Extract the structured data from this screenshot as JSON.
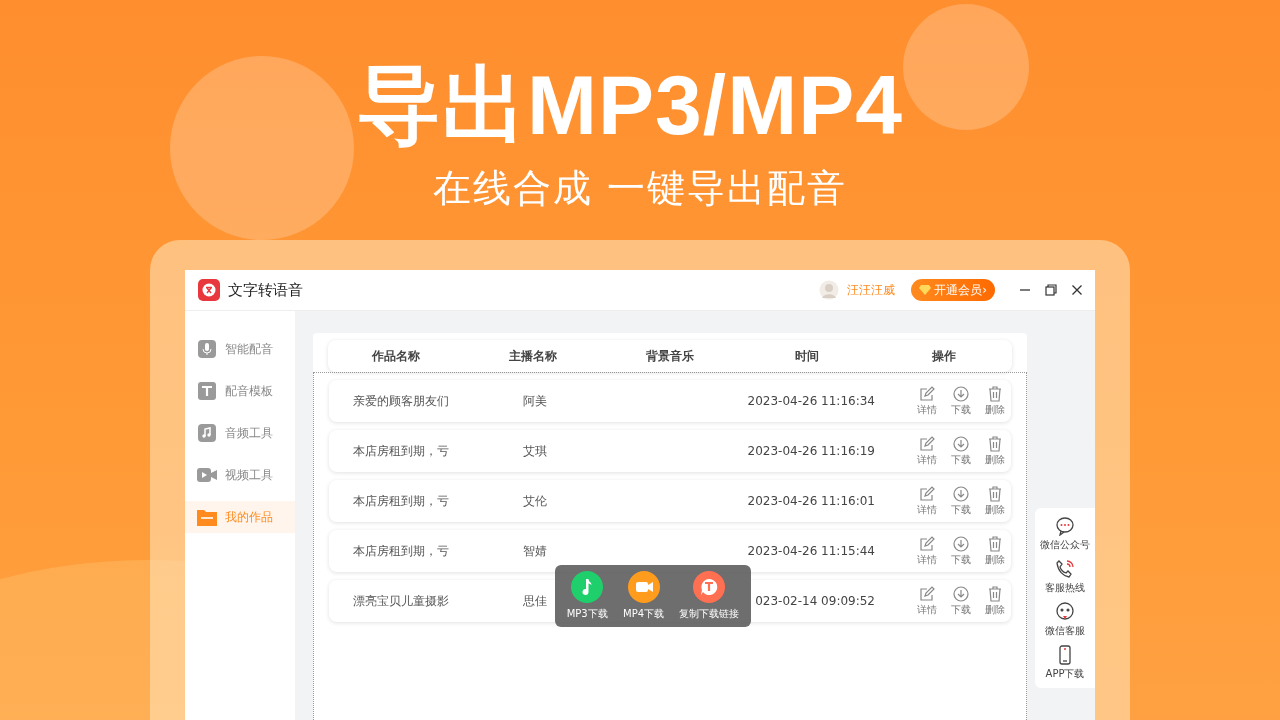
{
  "headline": "导出MP3/MP4",
  "subheadline": "在线合成 一键导出配音",
  "app": {
    "title": "文字转语音",
    "user": "汪汪汪威",
    "vip_button": "开通会员›"
  },
  "sidebar": {
    "items": [
      {
        "label": "智能配音",
        "selected": false
      },
      {
        "label": "配音模板",
        "selected": false
      },
      {
        "label": "音频工具",
        "selected": false
      },
      {
        "label": "视频工具",
        "selected": false
      },
      {
        "label": "我的作品",
        "selected": true
      }
    ]
  },
  "table": {
    "columns": [
      "作品名称",
      "主播名称",
      "背景音乐",
      "时间",
      "操作"
    ],
    "rows": [
      {
        "name": "亲爱的顾客朋友们",
        "anchor": "阿美",
        "time": "2023-04-26 11:16:34",
        "actions": [
          "详情",
          "下载",
          "删除"
        ]
      },
      {
        "name": "本店房租到期，亏",
        "anchor": "艾琪",
        "time": "2023-04-26 11:16:19",
        "actions": [
          "详情",
          "下载",
          "删除"
        ]
      },
      {
        "name": "本店房租到期，亏",
        "anchor": "艾伦",
        "time": "2023-04-26 11:16:01",
        "actions": [
          "详情",
          "下载",
          "删除"
        ]
      },
      {
        "name": "本店房租到期，亏",
        "anchor": "智婧",
        "time": "2023-04-26 11:15:44",
        "actions": [
          "详情",
          "下载",
          "删除"
        ]
      },
      {
        "name": "漂亮宝贝儿童摄影",
        "anchor": "思佳",
        "time": "023-02-14 09:09:52",
        "actions": [
          "详情",
          "下载",
          "删除"
        ]
      }
    ]
  },
  "export_popup": {
    "items": [
      {
        "label": "MP3下载",
        "color": "#1fcf6c"
      },
      {
        "label": "MP4下载",
        "color": "#ff9c1e"
      },
      {
        "label": "复制下载链接",
        "color": "#ff7052"
      }
    ]
  },
  "side_panel": {
    "items": [
      "微信公众号",
      "客服热线",
      "微信客服",
      "APP下载"
    ]
  }
}
